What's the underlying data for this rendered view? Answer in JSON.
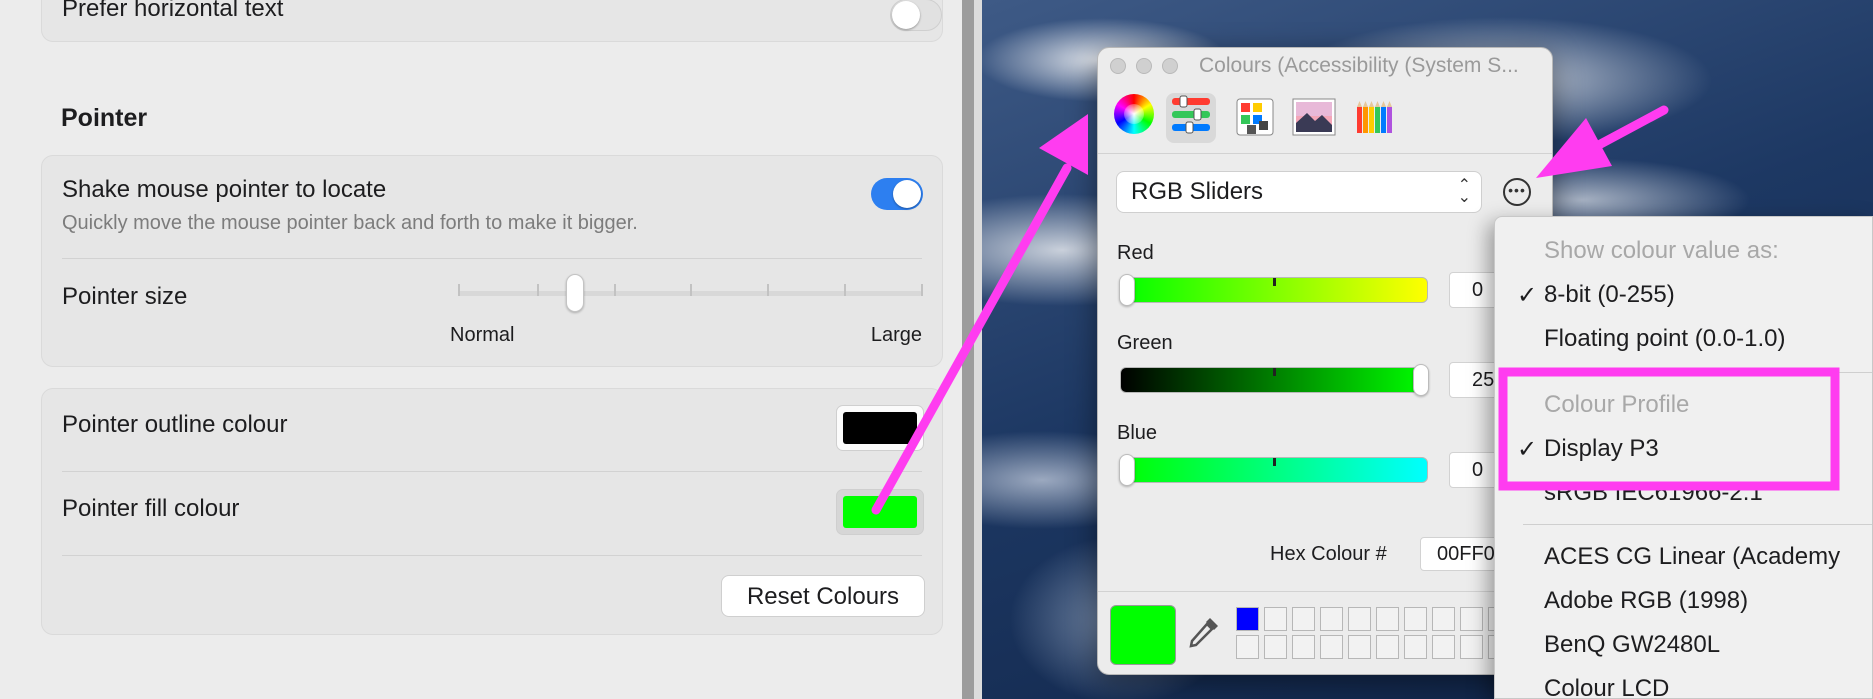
{
  "settings": {
    "top_row_label": "Prefer horizontal text",
    "section_title": "Pointer",
    "shake": {
      "label": "Shake mouse pointer to locate",
      "description": "Quickly move the mouse pointer back and forth to make it bigger."
    },
    "pointer_size": {
      "label": "Pointer size",
      "min_label": "Normal",
      "max_label": "Large",
      "level_fraction": 0.18
    },
    "outline": {
      "label": "Pointer outline colour",
      "color": "#000000"
    },
    "fill": {
      "label": "Pointer fill colour",
      "color": "#00ff00"
    },
    "reset_button": "Reset Colours"
  },
  "colours_window": {
    "title": "Colours (Accessibility (System S...",
    "toolbar_icons": [
      "colour-wheel-icon",
      "sliders-icon",
      "palettes-icon",
      "image-palettes-icon",
      "pencils-icon"
    ],
    "mode": "RGB Sliders",
    "sliders": [
      {
        "label": "Red",
        "value": "0",
        "level": 0
      },
      {
        "label": "Green",
        "value": "25",
        "level": 1
      },
      {
        "label": "Blue",
        "value": "0",
        "level": 0
      }
    ],
    "hex_label": "Hex Colour #",
    "hex_value": "00FF0",
    "current_color": "#00ff00",
    "first_swatch_color": "#0000ff"
  },
  "menu": {
    "header_value": "Show colour value as:",
    "item_8bit": "8-bit (0-255)",
    "item_float": "Floating point (0.0-1.0)",
    "header_profile": "Colour Profile",
    "item_display_p3": "Display P3",
    "item_srgb": "sRGB IEC61966-2.1",
    "item_aces": "ACES CG Linear (Academy",
    "item_adobe": "Adobe RGB (1998)",
    "item_benq": "BenQ GW2480L",
    "item_lcd": "Colour LCD"
  },
  "colors": {
    "accent": "#2d7ff0",
    "annotation": "#ff3cf0"
  }
}
